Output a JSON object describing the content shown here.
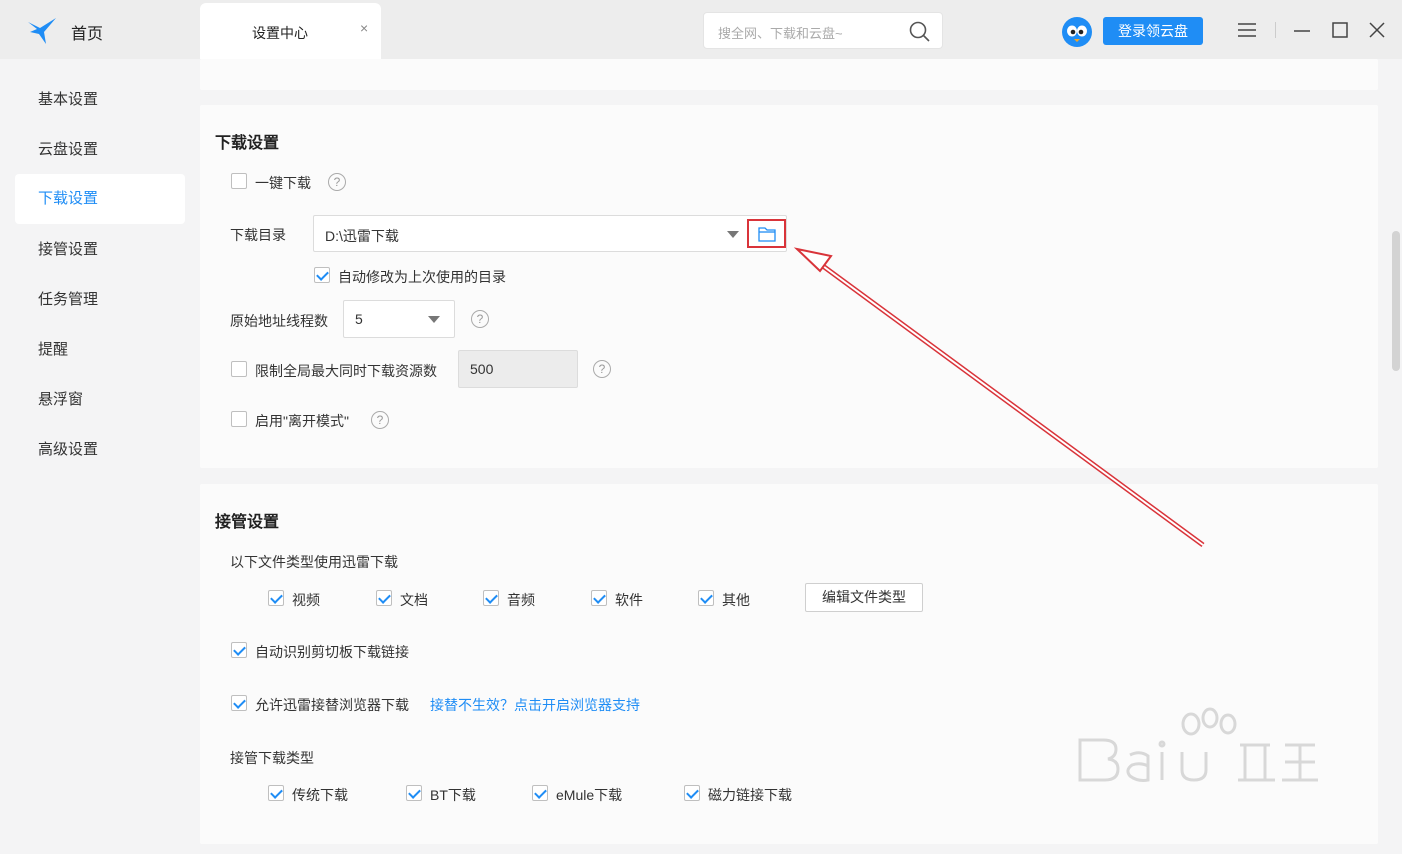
{
  "titlebar": {
    "home_label": "首页",
    "tab_label": "设置中心",
    "tab_close": "×",
    "search_placeholder": "搜全网、下载和云盘~",
    "login_label": "登录领云盘"
  },
  "sidebar": {
    "items": [
      {
        "label": "基本设置",
        "active": false
      },
      {
        "label": "云盘设置",
        "active": false
      },
      {
        "label": "下载设置",
        "active": true
      },
      {
        "label": "接管设置",
        "active": false
      },
      {
        "label": "任务管理",
        "active": false
      },
      {
        "label": "提醒",
        "active": false
      },
      {
        "label": "悬浮窗",
        "active": false
      },
      {
        "label": "高级设置",
        "active": false
      }
    ]
  },
  "download": {
    "title": "下载设置",
    "one_click": {
      "label": "一键下载",
      "checked": false
    },
    "dir_label": "下载目录",
    "dir_value": "D:\\迅雷下载",
    "auto_change": {
      "label": "自动修改为上次使用的目录",
      "checked": true
    },
    "threads_label": "原始地址线程数",
    "threads_value": "5",
    "limit": {
      "label": "限制全局最大同时下载资源数",
      "checked": false,
      "value": "500"
    },
    "away_mode": {
      "label": "启用\"离开模式\"",
      "checked": false
    }
  },
  "takeover": {
    "title": "接管设置",
    "filetypes_label": "以下文件类型使用迅雷下载",
    "filetypes": [
      {
        "label": "视频",
        "checked": true
      },
      {
        "label": "文档",
        "checked": true
      },
      {
        "label": "音频",
        "checked": true
      },
      {
        "label": "软件",
        "checked": true
      },
      {
        "label": "其他",
        "checked": true
      }
    ],
    "edit_button": "编辑文件类型",
    "clipboard": {
      "label": "自动识别剪切板下载链接",
      "checked": true
    },
    "browser": {
      "label": "允许迅雷接替浏览器下载",
      "checked": true
    },
    "browser_link": "接替不生效？点击开启浏览器支持",
    "types_label": "接管下载类型",
    "types": [
      {
        "label": "传统下载",
        "checked": true
      },
      {
        "label": "BT下载",
        "checked": true
      },
      {
        "label": "eMule下载",
        "checked": true
      },
      {
        "label": "磁力链接下载",
        "checked": true
      }
    ]
  },
  "help_glyph": "?",
  "colors": {
    "accent": "#1f8df5",
    "highlight": "#d9343a"
  }
}
